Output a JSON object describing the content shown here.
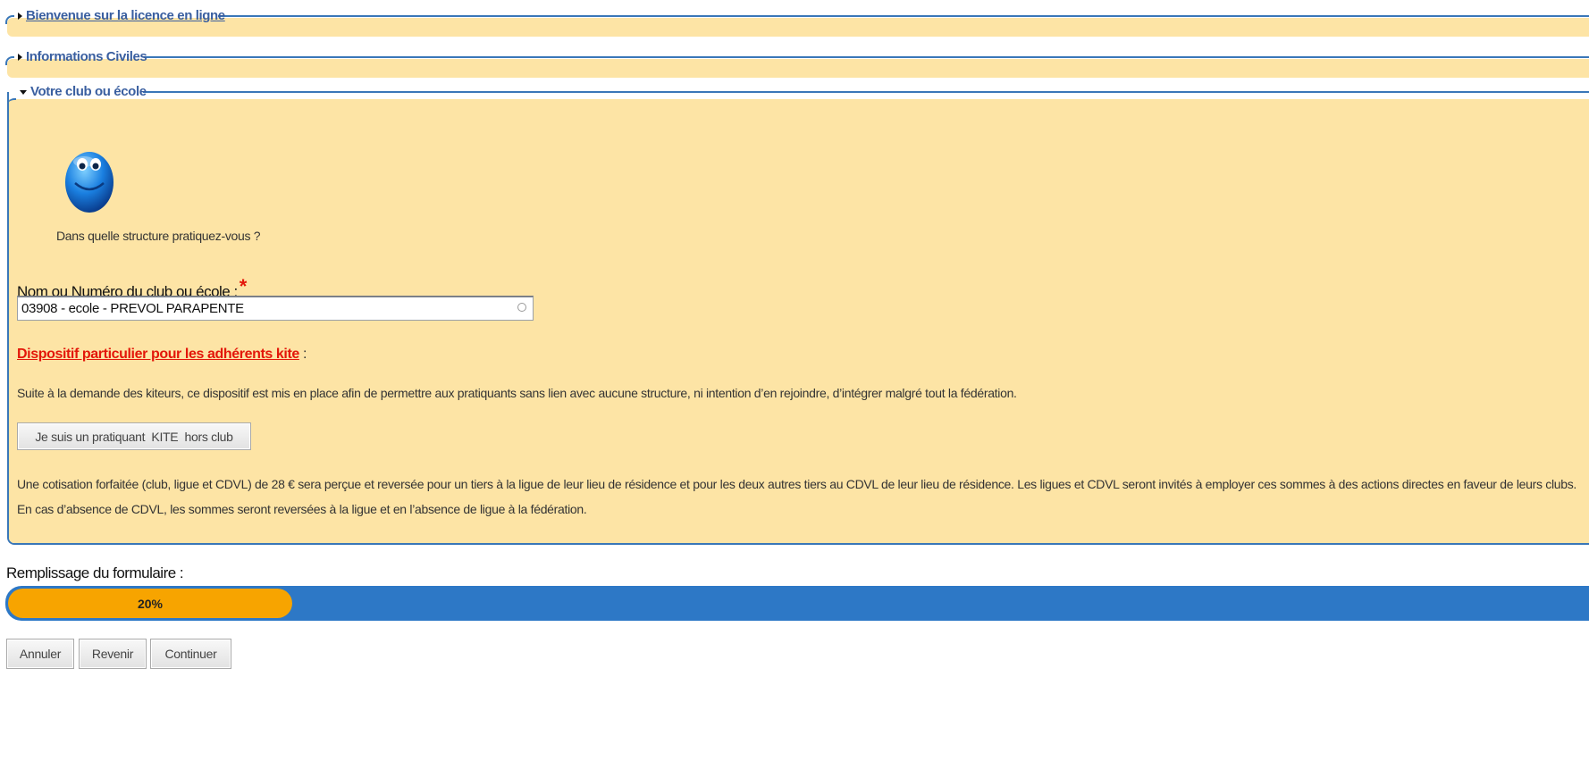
{
  "sections": {
    "welcome": {
      "title": "Bienvenue sur la licence en ligne",
      "expanded": false
    },
    "civil": {
      "title": "Informations Civiles",
      "expanded": false
    },
    "club": {
      "title": "Votre club ou école",
      "expanded": true
    }
  },
  "club_form": {
    "question": "Dans quelle structure pratiquez-vous ?",
    "field_label": "Nom ou Numéro du club ou école",
    "field_separator": " :",
    "required_mark": "*",
    "field_value": "03908 - ecole - PREVOL PARAPENTE",
    "kite_title": "Dispositif particulier pour les adhérents kite",
    "kite_suffix": " :",
    "kite_description": "Suite à la demande des kiteurs, ce dispositif est mis en place afin de permettre aux pratiquants sans lien avec aucune structure, ni intention d’en rejoindre, d’intégrer malgré tout la fédération.",
    "kite_button": "Je suis un pratiquant  KITE  hors club",
    "cotisation_text": "Une cotisation forfaitée (club, ligue et CDVL) de 28 € sera perçue et reversée pour un tiers à la ligue de leur lieu de résidence et pour les deux autres tiers au CDVL de leur lieu de résidence. Les ligues et CDVL seront invités à employer ces sommes à des actions directes en faveur de leurs clubs. En cas d’absence de CDVL, les sommes seront reversées à la ligue et en l’absence de ligue à la fédération."
  },
  "progress": {
    "label": "Remplissage du formulaire :",
    "value_text": "20%",
    "fraction": 0.2
  },
  "buttons": {
    "cancel": "Annuler",
    "back": "Revenir",
    "continue": "Continuer"
  },
  "colors": {
    "section_bg": "#fde4a5",
    "border_blue": "#3a77b8",
    "progress_track": "#2d78c6",
    "progress_fill": "#f7a400",
    "required_red": "#e3170a"
  },
  "icons": {
    "smiley": "blue-smiley-icon",
    "collapsed": "triangle-right-icon",
    "expanded": "triangle-down-icon",
    "input_status": "loading-circle-icon"
  }
}
